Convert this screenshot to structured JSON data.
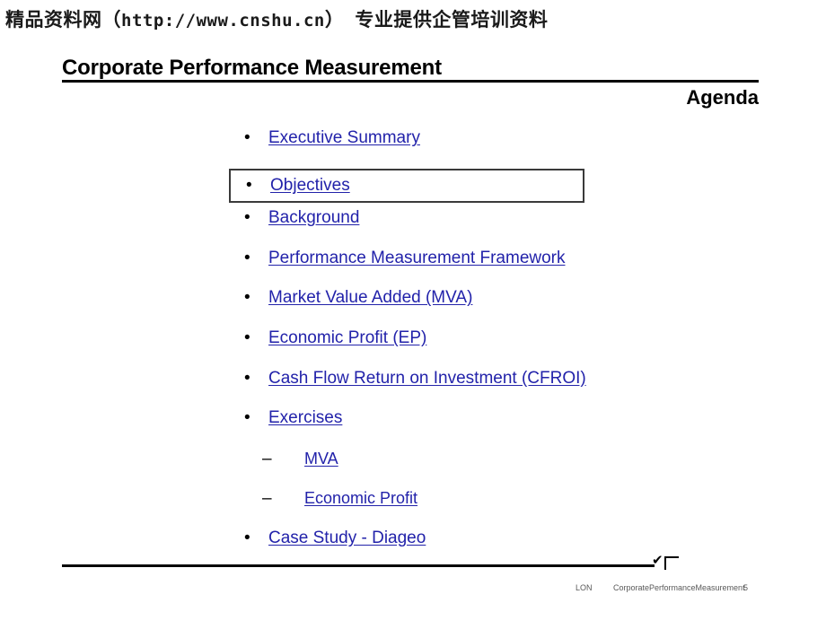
{
  "watermark": {
    "site": "精品资料网",
    "open_paren": "（",
    "url": "http://www.cnshu.cn",
    "close_paren": "）",
    "tagline": "专业提供企管培训资料"
  },
  "slide": {
    "title": "Corporate Performance Measurement",
    "section_label": "Agenda"
  },
  "agenda": {
    "bullet_marker": "•",
    "dash_marker": "–",
    "items": [
      {
        "label": "Executive Summary",
        "level": 1,
        "highlighted": false
      },
      {
        "label": "Objectives",
        "level": 1,
        "highlighted": true
      },
      {
        "label": "Background",
        "level": 1,
        "highlighted": false
      },
      {
        "label": "Performance Measurement Framework",
        "level": 1,
        "highlighted": false
      },
      {
        "label": "Market Value Added (MVA)",
        "level": 1,
        "highlighted": false
      },
      {
        "label": "Economic Profit (EP)",
        "level": 1,
        "highlighted": false
      },
      {
        "label": "Cash Flow Return on Investment (CFROI)",
        "level": 1,
        "highlighted": false
      },
      {
        "label": "Exercises",
        "level": 1,
        "highlighted": false
      },
      {
        "label": "MVA",
        "level": 2,
        "highlighted": false
      },
      {
        "label": "Economic Profit",
        "level": 2,
        "highlighted": false
      },
      {
        "label": "Case Study - Diageo",
        "level": 1,
        "highlighted": false
      }
    ]
  },
  "footer": {
    "check_glyph": "✔",
    "office": "LON",
    "document": "CorporatePerformanceMeasurement",
    "page_number": "5"
  },
  "colors": {
    "link": "#2222aa",
    "rule": "#000000",
    "highlight_border": "#3a3a3a",
    "footer_text": "#595959"
  }
}
